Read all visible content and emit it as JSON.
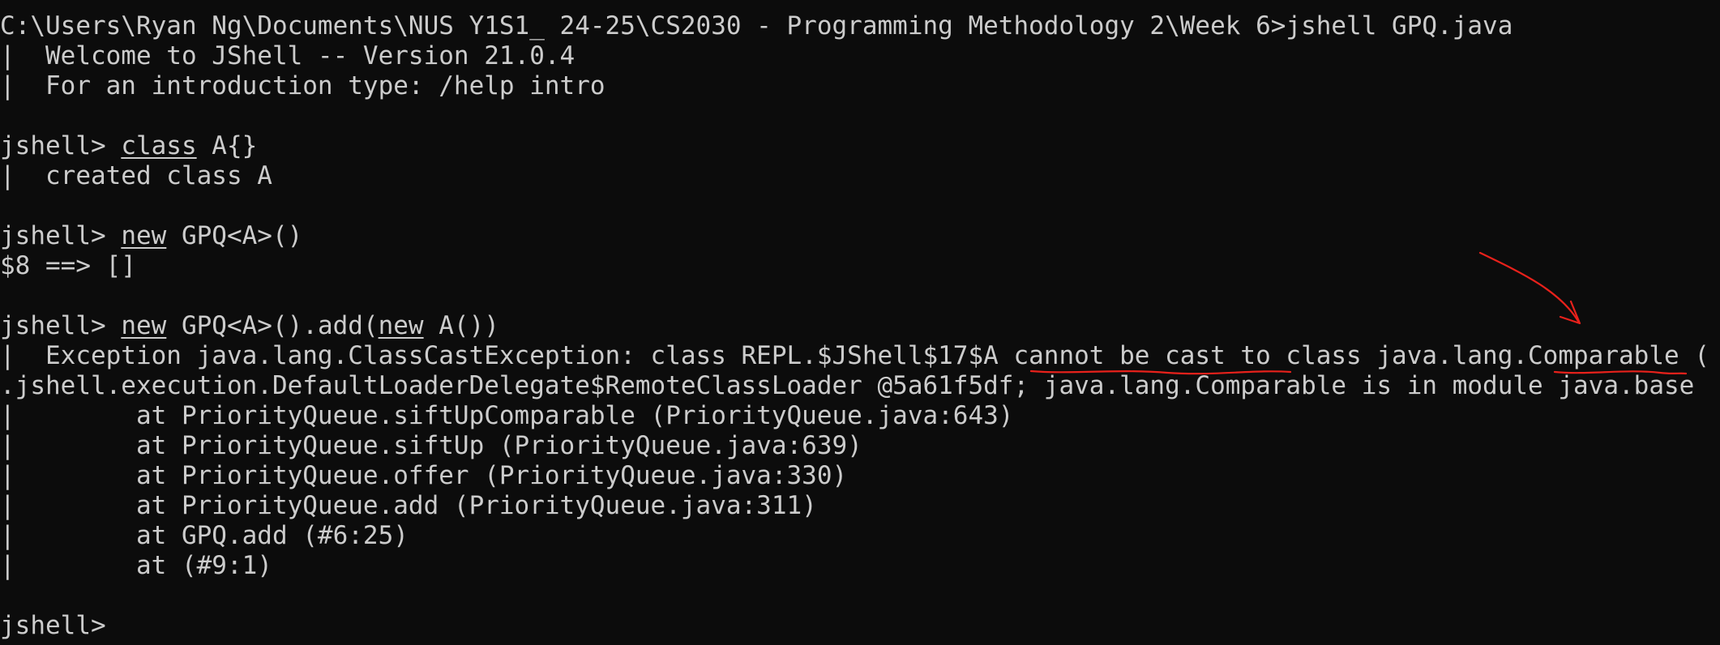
{
  "terminal": {
    "lines": [
      [
        {
          "t": "C:\\Users\\Ryan Ng\\Documents\\NUS Y1S1_ 24-25\\CS2030 - Programming Methodology 2\\Week 6>jshell GPQ.java"
        }
      ],
      [
        {
          "t": "|  Welcome to JShell -- Version 21.0.4"
        }
      ],
      [
        {
          "t": "|  For an introduction type: /help intro"
        }
      ],
      [
        {
          "t": ""
        }
      ],
      [
        {
          "t": "jshell> "
        },
        {
          "t": "class",
          "u": true
        },
        {
          "t": " A{}"
        }
      ],
      [
        {
          "t": "|  created class A"
        }
      ],
      [
        {
          "t": ""
        }
      ],
      [
        {
          "t": "jshell> "
        },
        {
          "t": "new",
          "u": true
        },
        {
          "t": " GPQ<A>()"
        }
      ],
      [
        {
          "t": "$8 ==> []"
        }
      ],
      [
        {
          "t": ""
        }
      ],
      [
        {
          "t": "jshell> "
        },
        {
          "t": "new",
          "u": true
        },
        {
          "t": " GPQ<A>().add("
        },
        {
          "t": "new",
          "u": true
        },
        {
          "t": " A())"
        }
      ],
      [
        {
          "t": "|  Exception java.lang.ClassCastException: class REPL.$JShell$17$A cannot be cast to class java.lang.Comparable ("
        }
      ],
      [
        {
          "t": ".jshell.execution.DefaultLoaderDelegate$RemoteClassLoader @5a61f5df; java.lang.Comparable is in module java.base"
        }
      ],
      [
        {
          "t": "|        at PriorityQueue.siftUpComparable (PriorityQueue.java:643)"
        }
      ],
      [
        {
          "t": "|        at PriorityQueue.siftUp (PriorityQueue.java:639)"
        }
      ],
      [
        {
          "t": "|        at PriorityQueue.offer (PriorityQueue.java:330)"
        }
      ],
      [
        {
          "t": "|        at PriorityQueue.add (PriorityQueue.java:311)"
        }
      ],
      [
        {
          "t": "|        at GPQ.add (#6:25)"
        }
      ],
      [
        {
          "t": "|        at (#9:1)"
        }
      ],
      [
        {
          "t": ""
        }
      ],
      [
        {
          "t": "jshell> "
        }
      ]
    ]
  },
  "colors": {
    "background": "#0c0c0c",
    "text": "#cccccc",
    "annotation": "#e8211b"
  }
}
